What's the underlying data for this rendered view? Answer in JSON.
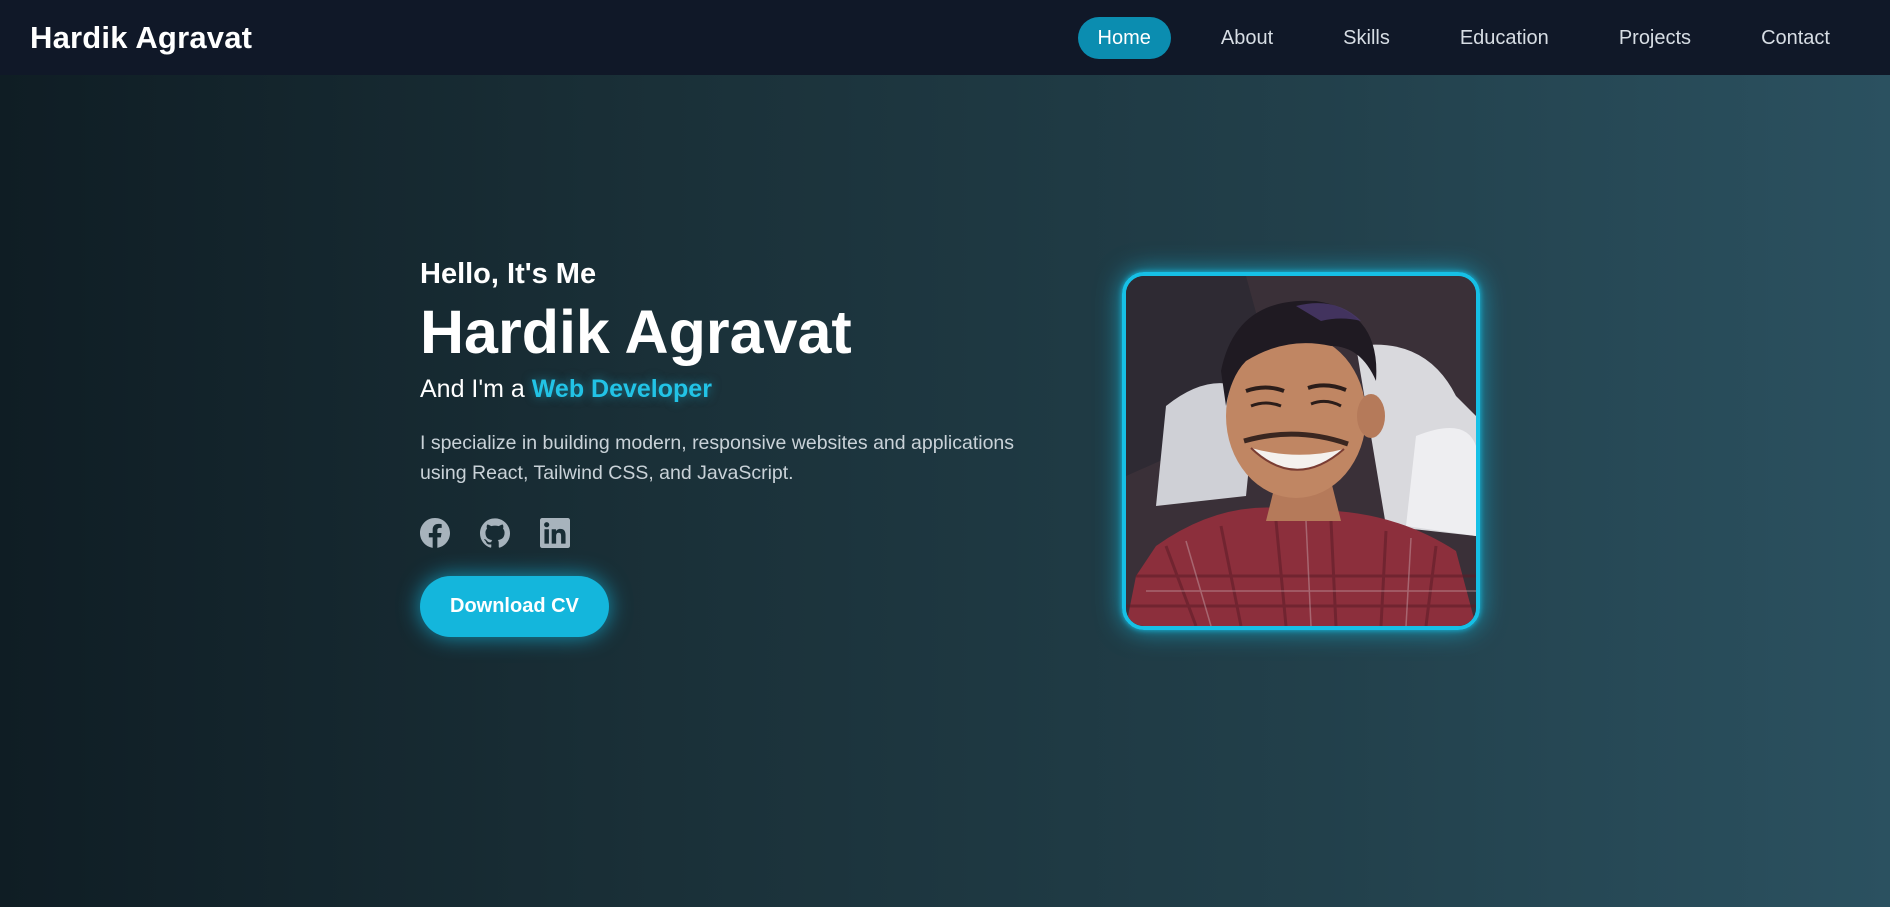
{
  "nav": {
    "brand": "Hardik Agravat",
    "links": [
      {
        "label": "Home",
        "active": true
      },
      {
        "label": "About"
      },
      {
        "label": "Skills"
      },
      {
        "label": "Education"
      },
      {
        "label": "Projects"
      },
      {
        "label": "Contact"
      }
    ]
  },
  "hero": {
    "greeting": "Hello, It's Me",
    "name": "Hardik Agravat",
    "role_prefix": "And I'm a ",
    "role_highlight": "Web Developer",
    "description": "I specialize in building modern, responsive websites and applications using React, Tailwind CSS, and JavaScript.",
    "socials": [
      {
        "icon": "facebook-icon"
      },
      {
        "icon": "github-icon"
      },
      {
        "icon": "linkedin-icon"
      }
    ],
    "cta_label": "Download CV"
  },
  "colors": {
    "accent": "#14b6dc",
    "nav_active": "#0b8db0",
    "navbar_bg": "#101828"
  }
}
